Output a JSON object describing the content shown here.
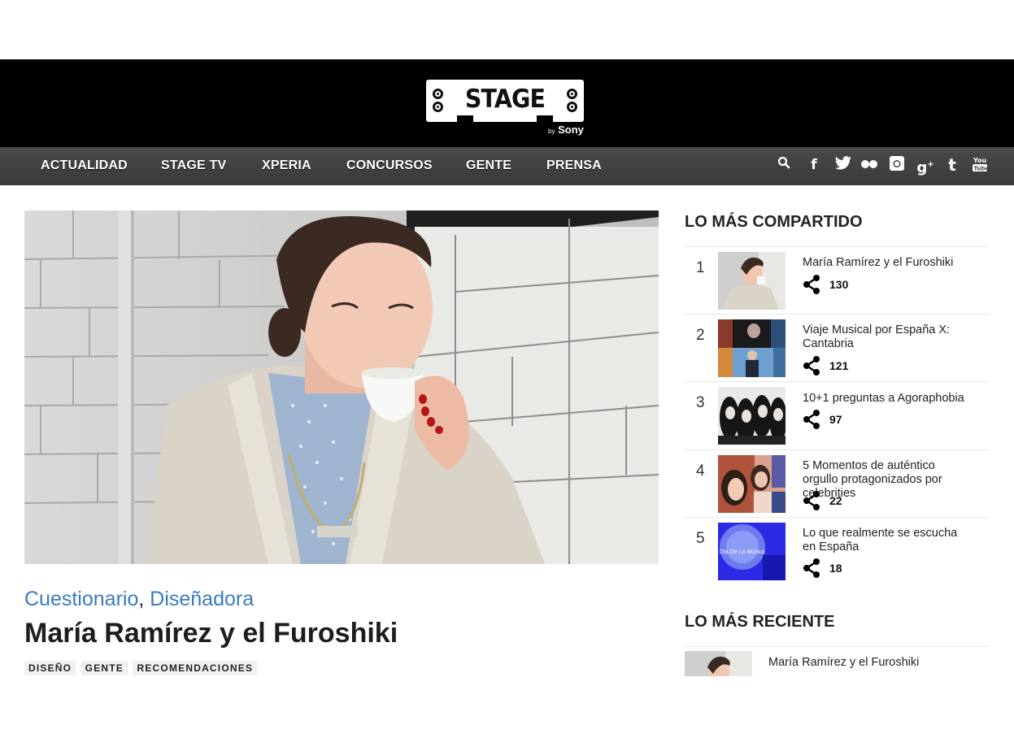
{
  "logo": {
    "text": "STAGE",
    "by": "by",
    "brand": "Sony"
  },
  "nav": {
    "items": [
      "ACTUALIDAD",
      "STAGE TV",
      "XPERIA",
      "CONCURSOS",
      "GENTE",
      "PRENSA"
    ],
    "icons": [
      "search-icon",
      "facebook-icon",
      "twitter-icon",
      "flickr-icon",
      "instagram-icon",
      "google-plus-icon",
      "tumblr-icon",
      "youtube-icon"
    ]
  },
  "article": {
    "categories": [
      "Cuestionario",
      "Diseñadora"
    ],
    "separator": ",",
    "title": "María Ramírez y el Furoshiki",
    "tags": [
      "DISEÑO",
      "GENTE",
      "RECOMENDACIONES"
    ]
  },
  "most_shared": {
    "heading": "LO MÁS COMPARTIDO",
    "items": [
      {
        "rank": "1",
        "title": "María Ramírez y el Furoshiki",
        "count": "130"
      },
      {
        "rank": "2",
        "title": "Viaje Musical por España X: Cantabria",
        "count": "121"
      },
      {
        "rank": "3",
        "title": "10+1 preguntas a Agoraphobia",
        "count": "97"
      },
      {
        "rank": "4",
        "title": "5 Momentos de auténtico orgullo protagonizados por celebrities",
        "count": "22"
      },
      {
        "rank": "5",
        "title": "Lo que realmente se escucha en España",
        "count": "18"
      }
    ]
  },
  "recent": {
    "heading": "LO MÁS RECIENTE",
    "items": [
      {
        "title": "María Ramírez y el Furoshiki"
      }
    ]
  },
  "thumb5_text": "Día De La Música",
  "colors": {
    "header_bg": "#000000",
    "nav_bg": "#444444",
    "link_blue": "#3a7bbf"
  }
}
